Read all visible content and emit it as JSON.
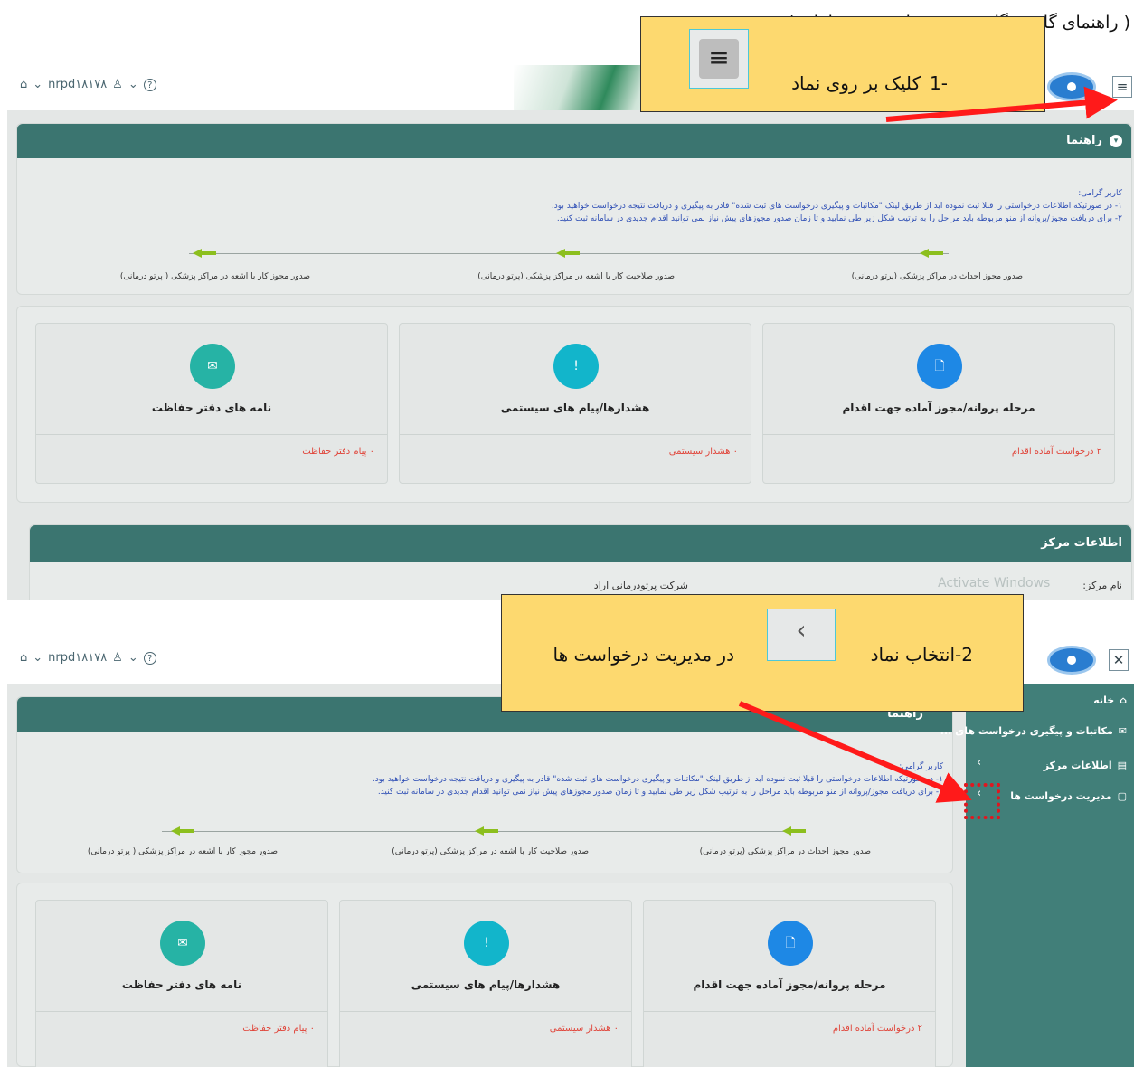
{
  "heading": "( راهنمای گام به گام ثبت درخواست در سامانه )",
  "topbar": {
    "username": "nrpd۱۸۱۷۸",
    "home_icon": "⌂",
    "user_icon": "♙",
    "help_icon": "?",
    "chevron": "⌄",
    "menu_icon": "≡",
    "close_icon": "✕"
  },
  "guide": {
    "header": "راهنما",
    "greeting": "کاربر گرامی:",
    "line1": "۱- در صورتیکه اطلاعات درخواستی را قبلا ثبت نموده اید از طریق لینک \"مکاتبات و پیگیری درخواست های ثبت شده\" قادر به پیگیری و دریافت نتیجه درخواست خواهید بود.",
    "line2": "۲- برای دریافت مجوز/پروانه از منو مربوطه باید مراحل را به ترتیب شکل زیر طی نمایید و تا زمان صدور مجوزهای پیش نیاز نمی توانید اقدام جدیدی در سامانه ثبت کنید.",
    "steps": [
      "صدور مجوز احداث در مراکز پزشکی (پرتو درمانی)",
      "صدور صلاحیت کار با اشعه در مراکز پزشکی (پرتو درمانی)",
      "صدور مجوز کار با اشعه در مراکز پزشکی ( پرتو درمانی)"
    ]
  },
  "tiles": [
    {
      "title": "مرحله پروانه/مجوز آماده جهت اقدام",
      "link": "۲ درخواست آماده اقدام",
      "color": "#1e88e5",
      "icon": "🗋"
    },
    {
      "title": "هشدارها/پیام های سیستمی",
      "link": "۰ هشدار سیستمی",
      "color": "#12b5cb",
      "icon": "!"
    },
    {
      "title": "نامه های دفتر حفاظت",
      "link": "۰ پیام دفتر حفاظت",
      "color": "#26b3a5",
      "icon": "✉"
    }
  ],
  "center_info": {
    "header": "اطلاعات مرکز",
    "name_label": "نام مرکز:",
    "name_value": "شرکت پرتودرمانی اراد"
  },
  "watermark": "Activate Windows",
  "note1": {
    "number": "1-",
    "text": "کلیک بر روی نماد"
  },
  "note2": {
    "prefix": "2-انتخاب نماد",
    "suffix": "در مدیریت درخواست ها",
    "chev": "‹"
  },
  "sidebar": {
    "items": [
      {
        "label": "خانه",
        "icon": "⌂"
      },
      {
        "label": "مکاتبات و پیگیری درخواست های ...",
        "icon": "✉"
      },
      {
        "label": "اطلاعات مرکز",
        "icon": "▤"
      },
      {
        "label": "مدیریت درخواست ها",
        "icon": "▢"
      }
    ],
    "chev": "‹"
  },
  "colors": {
    "accent": "#3b7570",
    "sidebar": "#417f79",
    "note": "#fdd96f",
    "arrow": "#ff1a1a",
    "link": "#e0453a"
  }
}
